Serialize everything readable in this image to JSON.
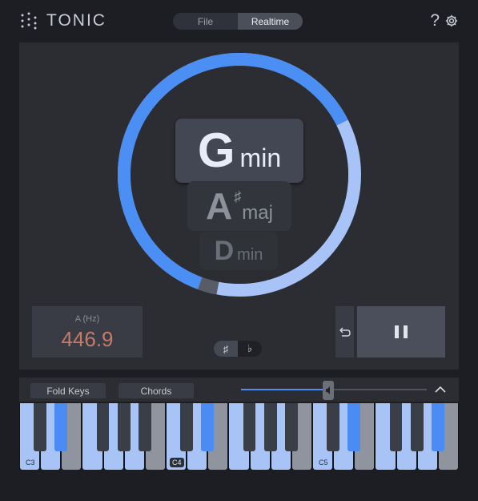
{
  "app": {
    "title": "TONIC"
  },
  "header": {
    "mode_tabs": [
      {
        "label": "File",
        "active": false
      },
      {
        "label": "Realtime",
        "active": true
      }
    ],
    "help_label": "?"
  },
  "keys_detected": [
    {
      "root": "G",
      "accidental": "",
      "quality": "min",
      "rank": 1
    },
    {
      "root": "A",
      "accidental": "♯",
      "quality": "maj",
      "rank": 2
    },
    {
      "root": "D",
      "accidental": "",
      "quality": "min",
      "rank": 3
    }
  ],
  "confidence_ring": {
    "progress": 0.62,
    "colors": {
      "filled": "#4b8ef4",
      "remaining": "#a7c3f8",
      "marker": "#575c67"
    }
  },
  "tuning": {
    "label": "A (Hz)",
    "value": "446.9"
  },
  "accidental_toggle": [
    {
      "label": "♯",
      "active": true
    },
    {
      "label": "♭",
      "active": false
    }
  ],
  "transport": {
    "reset_icon": "undo-icon",
    "pause_icon": "pause-icon"
  },
  "keyboard_toolbar": {
    "fold_keys_label": "Fold Keys",
    "chords_label": "Chords",
    "volume": 0.47,
    "collapse_icon": "chevron-up-icon"
  },
  "keyboard": {
    "octave_labels": [
      "C3",
      "C4",
      "C5"
    ],
    "highlighted_white": [
      0,
      1,
      3,
      4,
      5,
      7,
      8,
      10,
      11,
      12,
      14,
      15,
      17,
      18,
      19
    ],
    "highlighted_black": [
      1,
      6,
      11,
      14
    ],
    "colors": {
      "white_lit": "#a8c4f7",
      "white_dim": "#8f949e",
      "black_lit": "#4a8cf3",
      "black_dim": "#3a3e47"
    }
  }
}
